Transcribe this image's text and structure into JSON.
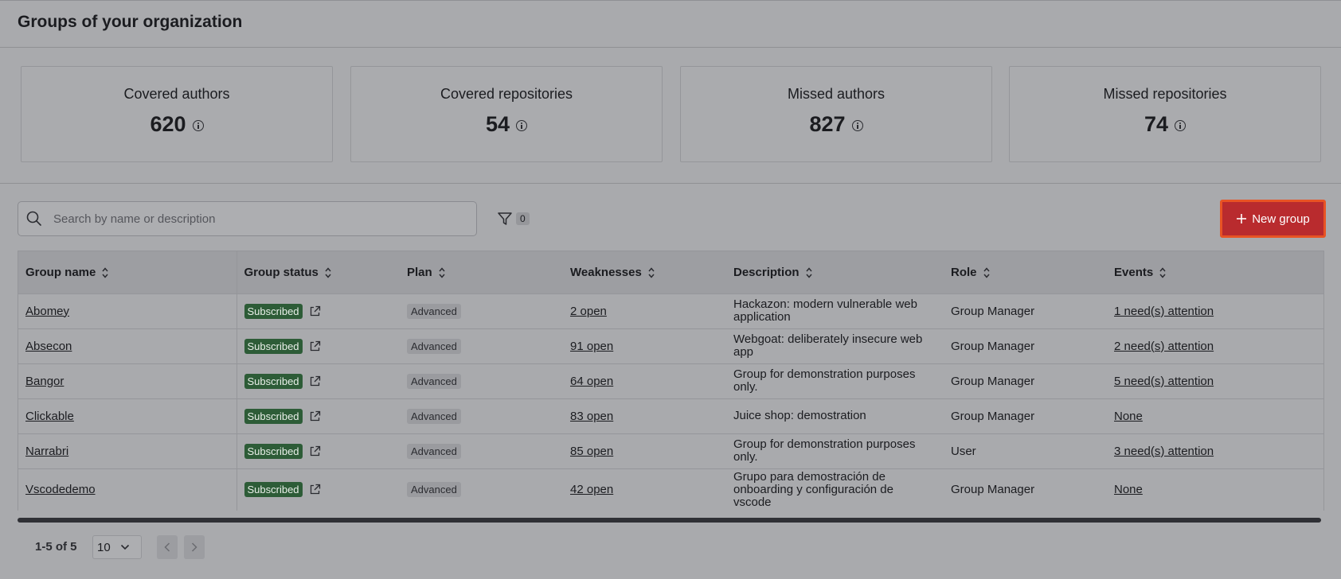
{
  "header": {
    "title": "Groups of your organization"
  },
  "stats": [
    {
      "label": "Covered authors",
      "value": "620"
    },
    {
      "label": "Covered repositories",
      "value": "54"
    },
    {
      "label": "Missed authors",
      "value": "827"
    },
    {
      "label": "Missed repositories",
      "value": "74"
    }
  ],
  "toolbar": {
    "search_placeholder": "Search by name or description",
    "filter_count": "0",
    "new_group_label": "New group"
  },
  "table": {
    "columns": [
      "Group name",
      "Group status",
      "Plan",
      "Weaknesses",
      "Description",
      "Role",
      "Events"
    ],
    "rows": [
      {
        "name": "Abomey",
        "status": "Subscribed",
        "plan": "Advanced",
        "weaknesses": "2 open",
        "description": "Hackazon: modern vulnerable web application",
        "role": "Group Manager",
        "events": "1 need(s) attention"
      },
      {
        "name": "Absecon",
        "status": "Subscribed",
        "plan": "Advanced",
        "weaknesses": "91 open",
        "description": "Webgoat: deliberately insecure web app",
        "role": "Group Manager",
        "events": "2 need(s) attention"
      },
      {
        "name": "Bangor",
        "status": "Subscribed",
        "plan": "Advanced",
        "weaknesses": "64 open",
        "description": "Group for demonstration purposes only.",
        "role": "Group Manager",
        "events": "5 need(s) attention"
      },
      {
        "name": "Clickable",
        "status": "Subscribed",
        "plan": "Advanced",
        "weaknesses": "83 open",
        "description": "Juice shop: demostration",
        "role": "Group Manager",
        "events": "None"
      },
      {
        "name": "Narrabri",
        "status": "Subscribed",
        "plan": "Advanced",
        "weaknesses": "85 open",
        "description": "Group for demonstration purposes only.",
        "role": "User",
        "events": "3 need(s) attention"
      },
      {
        "name": "Vscodedemo",
        "status": "Subscribed",
        "plan": "Advanced",
        "weaknesses": "42 open",
        "description": "Grupo para demostración de onboarding y configuración de vscode",
        "role": "Group Manager",
        "events": "None"
      }
    ]
  },
  "pagination": {
    "range_text": "1-5 of 5",
    "page_size": "10"
  },
  "colors": {
    "accent": "#b92b2e",
    "highlight_border": "#e85324",
    "subscribed": "#2d5c37"
  }
}
